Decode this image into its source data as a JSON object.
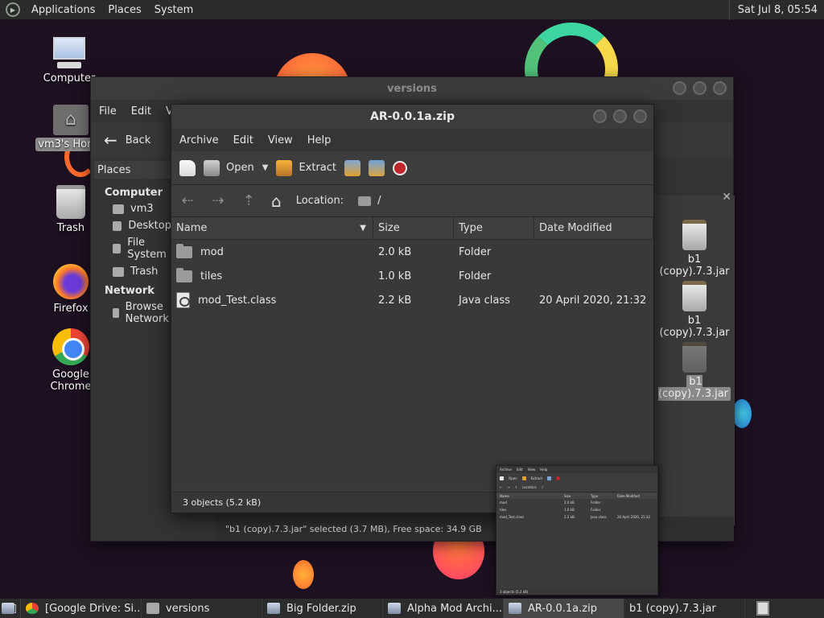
{
  "top_panel": {
    "menus": [
      "Applications",
      "Places",
      "System"
    ],
    "clock": "Sat Jul  8, 05:54"
  },
  "desktop_icons": {
    "computer": "Computer",
    "home": "vm3's Home",
    "trash": "Trash",
    "firefox": "Firefox",
    "chrome": "Google Chrome"
  },
  "back_window": {
    "title": "versions",
    "menus": [
      "File",
      "Edit",
      "View"
    ],
    "back_label": "Back",
    "places_label": "Places",
    "sidebar": {
      "computer_heading": "Computer",
      "computer_items": [
        "vm3",
        "Desktop",
        "File System",
        "Trash"
      ],
      "network_heading": "Network",
      "network_items": [
        "Browse Network"
      ]
    },
    "jar_labels": [
      "b1 (copy).7.3.jar",
      "b1 (copy).7.3.jar",
      "b1 (copy).7.3.jar"
    ],
    "status": "\"b1 (copy).7.3.jar\" selected (3.7 MB), Free space: 34.9 GB"
  },
  "archive_window": {
    "title": "AR-0.0.1a.zip",
    "menus": [
      "Archive",
      "Edit",
      "View",
      "Help"
    ],
    "toolbar": {
      "open_label": "Open",
      "extract_label": "Extract"
    },
    "location": {
      "label": "Location:",
      "path": "/"
    },
    "columns": [
      "Name",
      "Size",
      "Type",
      "Date Modified"
    ],
    "rows": [
      {
        "name": "mod",
        "size": "2.0 kB",
        "type": "Folder",
        "date": "",
        "icon": "folder-icon"
      },
      {
        "name": "tiles",
        "size": "1.0 kB",
        "type": "Folder",
        "date": "",
        "icon": "folder-icon"
      },
      {
        "name": "mod_Test.class",
        "size": "2.2 kB",
        "type": "Java class",
        "date": "20 April 2020, 21:32",
        "icon": "class-file-icon"
      }
    ],
    "status": "3 objects (5.2 kB)"
  },
  "taskbar": {
    "tasks": [
      {
        "label": "[Google Drive: Si...",
        "icon": "chrome-icon"
      },
      {
        "label": "versions",
        "icon": "folder-icon"
      },
      {
        "label": "Big Folder.zip",
        "icon": "archive-icon"
      },
      {
        "label": "Alpha Mod Archi...",
        "icon": "archive-icon"
      },
      {
        "label": "AR-0.0.1a.zip",
        "icon": "archive-icon",
        "active": true
      },
      {
        "label": "b1 (copy).7.3.jar",
        "icon": "archive-icon"
      }
    ]
  },
  "colors": {
    "desktop_bg": "#1d1020",
    "window_bg": "#3a3a3a",
    "stop_red": "#c0272d"
  }
}
